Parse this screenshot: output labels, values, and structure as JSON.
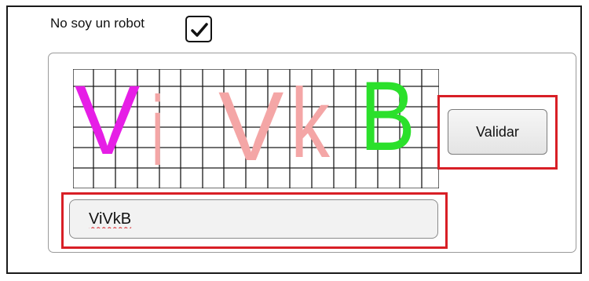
{
  "robot_check": {
    "label": "No soy un robot",
    "checked": true,
    "icon": "checkmark-icon"
  },
  "captcha": {
    "characters": [
      {
        "char": "V",
        "color": "#e61ee6"
      },
      {
        "char": "i",
        "color": "#f4a6a6"
      },
      {
        "char": "V",
        "color": "#f4a6a6"
      },
      {
        "char": "k",
        "color": "#f4a6a6"
      },
      {
        "char": "B",
        "color": "#2be02b"
      }
    ],
    "grid_color": "#1a1a1a"
  },
  "validate_button": {
    "label": "Validar"
  },
  "captcha_input": {
    "value": "ViVkB"
  },
  "highlight_color": "#d81f26"
}
